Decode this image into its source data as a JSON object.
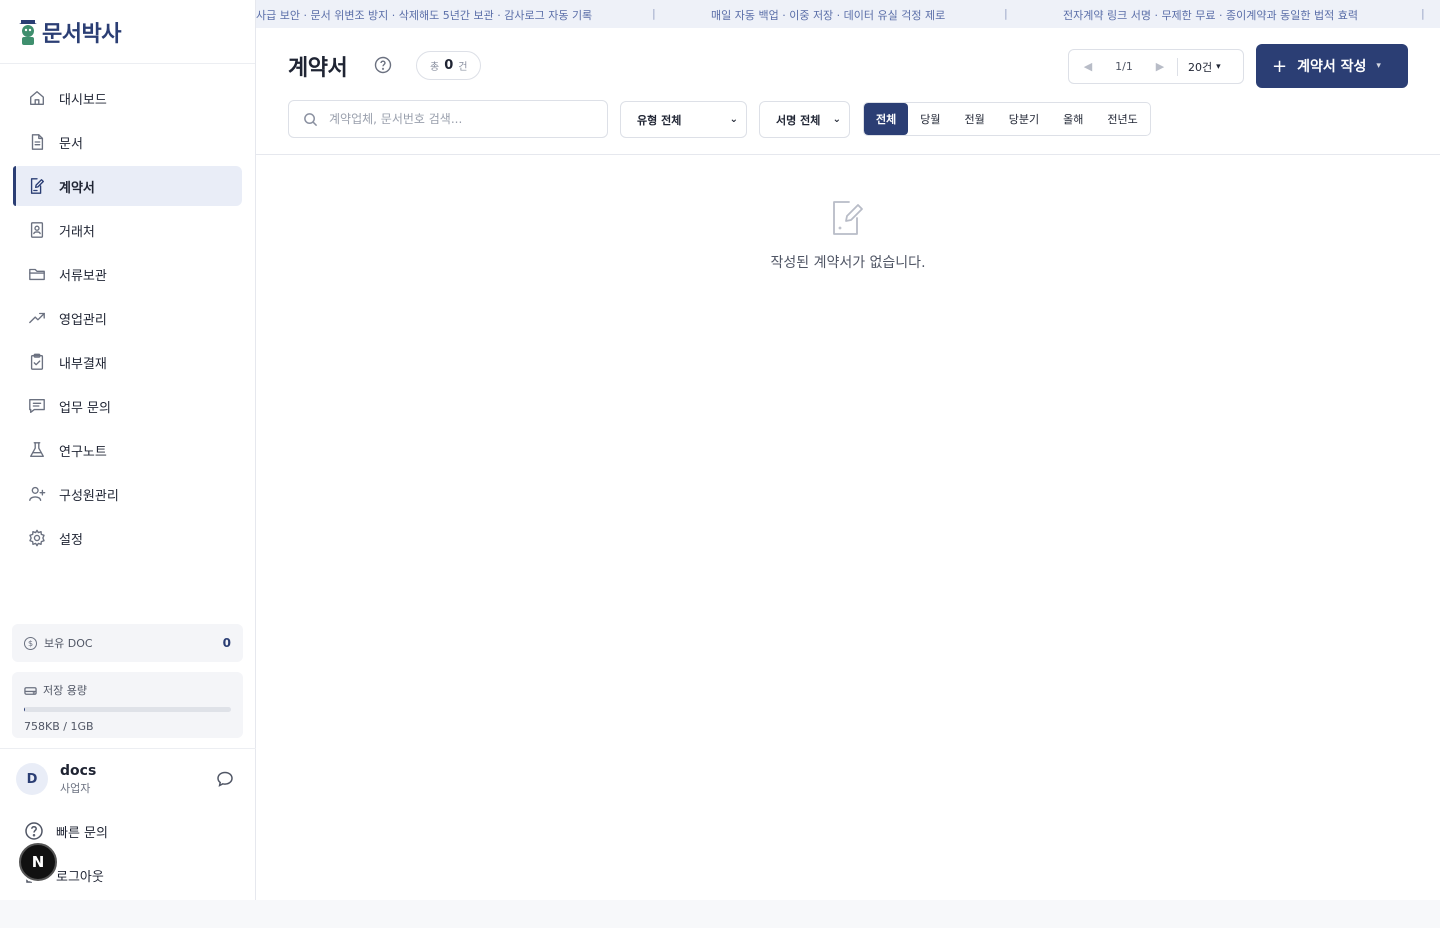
{
  "brand": {
    "name": "문서박사",
    "accent": "#2b3e74"
  },
  "ticker": [
    "사급 보안 · 문서 위변조 방지 · 삭제해도 5년간 보관 · 감사로그 자동 기록",
    "매일 자동 백업 · 이중 저장 · 데이터 유실 걱정 제로",
    "전자계약 링크 서명 · 무제한 무료 · 종이계약과 동일한 법적 효력"
  ],
  "sidebar": {
    "items": [
      {
        "label": "대시보드",
        "icon": "home-icon"
      },
      {
        "label": "문서",
        "icon": "document-icon"
      },
      {
        "label": "계약서",
        "icon": "contract-edit-icon",
        "active": true
      },
      {
        "label": "거래처",
        "icon": "contact-card-icon"
      },
      {
        "label": "서류보관",
        "icon": "folder-icon"
      },
      {
        "label": "영업관리",
        "icon": "trending-up-icon"
      },
      {
        "label": "내부결재",
        "icon": "clipboard-check-icon"
      },
      {
        "label": "업무 문의",
        "icon": "message-square-icon"
      },
      {
        "label": "연구노트",
        "icon": "flask-icon"
      },
      {
        "label": "구성원관리",
        "icon": "user-plus-icon"
      },
      {
        "label": "설정",
        "icon": "gear-icon"
      }
    ],
    "doc_balance": {
      "label": "보유 DOC",
      "value": "0"
    },
    "storage": {
      "label": "저장 용량",
      "used_text": "758KB / 1GB",
      "fraction": 0.0007
    },
    "user": {
      "initial": "D",
      "name": "docs",
      "role": "사업자"
    },
    "quick_inquiry": "빠른 문의",
    "logout": "로그아웃",
    "n_badge": "N"
  },
  "main": {
    "title": "계약서",
    "count": {
      "prefix": "총",
      "value": "0",
      "suffix": "건"
    },
    "pager": {
      "prev": "◀",
      "page": "1/1",
      "next": "▶",
      "per_page": "20건"
    },
    "create_button": {
      "plus": "+",
      "label": "계약서 작성"
    },
    "search": {
      "placeholder": "계약업체, 문서번호 검색...",
      "value": ""
    },
    "type_filter": "유형 전체",
    "sign_filter": "서명 전체",
    "periods": [
      "전체",
      "당월",
      "전월",
      "당분기",
      "올해",
      "전년도"
    ],
    "active_period": "전체",
    "empty_message": "작성된 계약서가 없습니다."
  }
}
